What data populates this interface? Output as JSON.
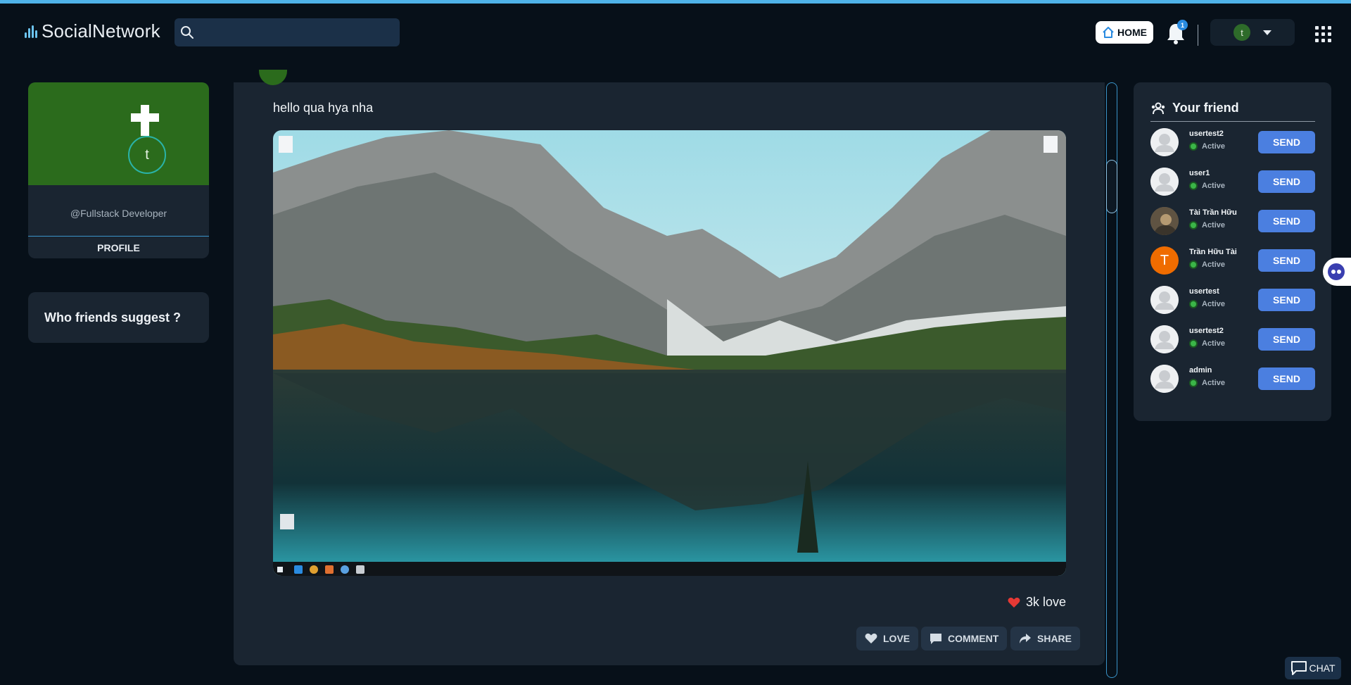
{
  "brand": {
    "name": "SocialNetwork",
    "accent": "#6cc3ee"
  },
  "header": {
    "search_placeholder": "",
    "home_label": "HOME",
    "notification_count": "1",
    "user_initial": "t"
  },
  "profile": {
    "initial": "t",
    "handle": "@Fullstack Developer",
    "button_label": "PROFILE"
  },
  "suggest": {
    "title": "Who friends suggest ?"
  },
  "post": {
    "text": "hello qua hya nha",
    "image_icon": "desktop-screenshot-image",
    "likes": "3k love",
    "actions": {
      "love": "LOVE",
      "comment": "COMMENT",
      "share": "SHARE"
    }
  },
  "friends": {
    "title": "Your friend",
    "send_label": "SEND",
    "items": [
      {
        "name": "usertest2",
        "status": "Active",
        "avatar": "default-avatar"
      },
      {
        "name": "user1",
        "status": "Active",
        "avatar": "default-avatar"
      },
      {
        "name": "Tài Trần Hữu",
        "status": "Active",
        "avatar": "photo-avatar"
      },
      {
        "name": "Trần Hữu Tài",
        "status": "Active",
        "avatar": "letter-avatar",
        "initial": "T"
      },
      {
        "name": "usertest",
        "status": "Active",
        "avatar": "default-avatar"
      },
      {
        "name": "usertest2",
        "status": "Active",
        "avatar": "default-avatar"
      },
      {
        "name": "admin",
        "status": "Active",
        "avatar": "default-avatar"
      }
    ]
  },
  "chat": {
    "label": "CHAT"
  },
  "colors": {
    "background": "#071019",
    "card": "#1a2531",
    "send_button": "#4b7fe0",
    "cover": "#2b6b1c"
  }
}
